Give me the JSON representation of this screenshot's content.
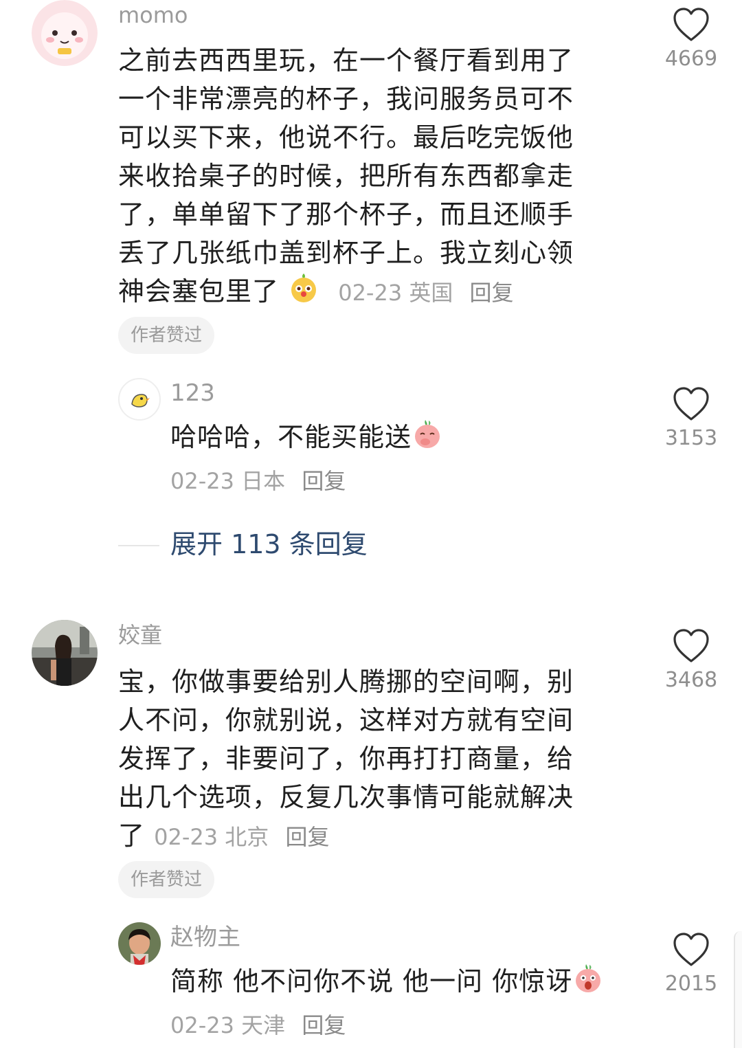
{
  "comments": [
    {
      "username": "momo",
      "lines": [
        "之前去西西里玩，在一个餐厅看到用了",
        "一个非常漂亮的杯子，我问服务员可不",
        "可以买下来，他说不行。最后吃完饭他",
        "来收拾桌子的时候，把所有东西都拿走",
        "了，单单留下了那个杯子，而且还顺手",
        "丢了几张纸巾盖到杯子上。我立刻心领"
      ],
      "last_line": "神会塞包里了",
      "date": "02-23",
      "location": "英国",
      "reply_label": "回复",
      "badge": "作者赞过",
      "likes": "4669"
    },
    {
      "username": "姣童",
      "lines": [
        "宝，你做事要给别人腾挪的空间啊，别",
        "人不问，你就别说，这样对方就有空间",
        "发挥了，非要问了，你再打打商量，给",
        "出几个选项，反复几次事情可能就解决"
      ],
      "last_line": "了",
      "date": "02-23",
      "location": "北京",
      "reply_label": "回复",
      "badge": "作者赞过",
      "likes": "3468"
    }
  ],
  "replies": [
    {
      "username": "123",
      "text": "哈哈哈，不能买能送",
      "date": "02-23",
      "location": "日本",
      "reply_label": "回复",
      "likes": "3153"
    },
    {
      "username": "赵物主",
      "text": "简称 他不问你不说 他一问 你惊讶",
      "date": "02-23",
      "location": "天津",
      "reply_label": "回复",
      "likes": "2015"
    }
  ],
  "expand_replies": "展开 113 条回复",
  "icons": {
    "like": "heart-outline-icon",
    "emoji_1": "fruit-smile-emoji",
    "emoji_2": "peach-shy-emoji",
    "emoji_3": "peach-surprised-emoji"
  },
  "colors": {
    "username": "#9b9b9b",
    "text": "#1f1f1f",
    "meta": "#a3a3a3",
    "link": "#2e4a6f",
    "badge_bg": "#f3f3f3"
  }
}
